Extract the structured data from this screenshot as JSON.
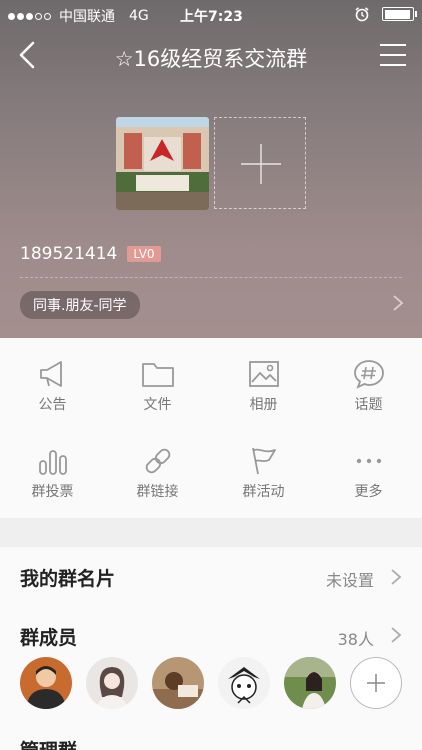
{
  "status": {
    "carrier": "中国联通",
    "network": "4G",
    "time": "上午7:23",
    "signal_full": 3,
    "signal_total": 5,
    "battery_level": 0.95
  },
  "nav": {
    "title": "☆16级经贸系交流群"
  },
  "group": {
    "id": "189521414",
    "level": "LV0",
    "tag": "同事.朋友-同学"
  },
  "features": [
    {
      "label": "公告",
      "icon": "megaphone-icon"
    },
    {
      "label": "文件",
      "icon": "folder-icon"
    },
    {
      "label": "相册",
      "icon": "photo-album-icon"
    },
    {
      "label": "话题",
      "icon": "hashtag-icon"
    },
    {
      "label": "群投票",
      "icon": "bar-chart-icon"
    },
    {
      "label": "群链接",
      "icon": "link-icon"
    },
    {
      "label": "群活动",
      "icon": "flag-icon"
    },
    {
      "label": "更多",
      "icon": "more-icon"
    }
  ],
  "card": {
    "title": "我的群名片",
    "value": "未设置"
  },
  "members": {
    "title": "群成员",
    "count": "38人"
  },
  "next_section": {
    "title": "管理群"
  },
  "colors": {
    "header_top": "#6e6a6b",
    "header_bottom": "#a48f8f",
    "level_badge": "#e29a94"
  }
}
